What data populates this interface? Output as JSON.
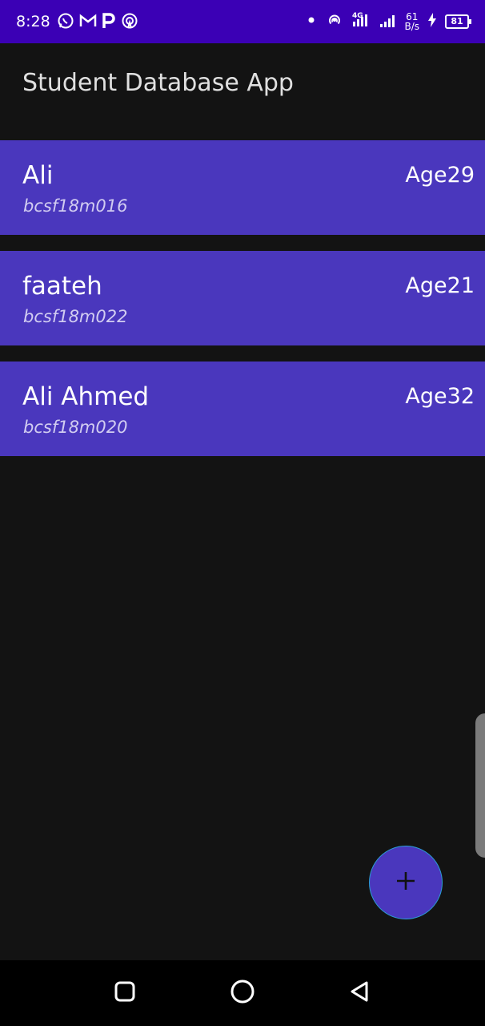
{
  "status_bar": {
    "time": "8:28",
    "left_icons": [
      "whatsapp-icon",
      "gmail-icon",
      "paytm-icon",
      "radar-icon"
    ],
    "net_speed_value": "61",
    "net_speed_unit": "B/s",
    "network_type": "4G",
    "battery_level": "81",
    "background_color": "#3b00b5"
  },
  "app_bar": {
    "title": "Student Database App"
  },
  "students": [
    {
      "name": "Ali",
      "roll": "bcsf18m016",
      "age": "Age29"
    },
    {
      "name": "faateh",
      "roll": "bcsf18m022",
      "age": "Age21"
    },
    {
      "name": "Ali Ahmed",
      "roll": "bcsf18m020",
      "age": "Age32"
    }
  ],
  "fab": {
    "icon": "plus-icon"
  },
  "nav_bar": {
    "buttons": [
      "square-recents-icon",
      "circle-home-icon",
      "triangle-back-icon"
    ]
  },
  "colors": {
    "card": "#4a37bd",
    "background": "#131313",
    "fab_border": "#2a9fd6"
  }
}
